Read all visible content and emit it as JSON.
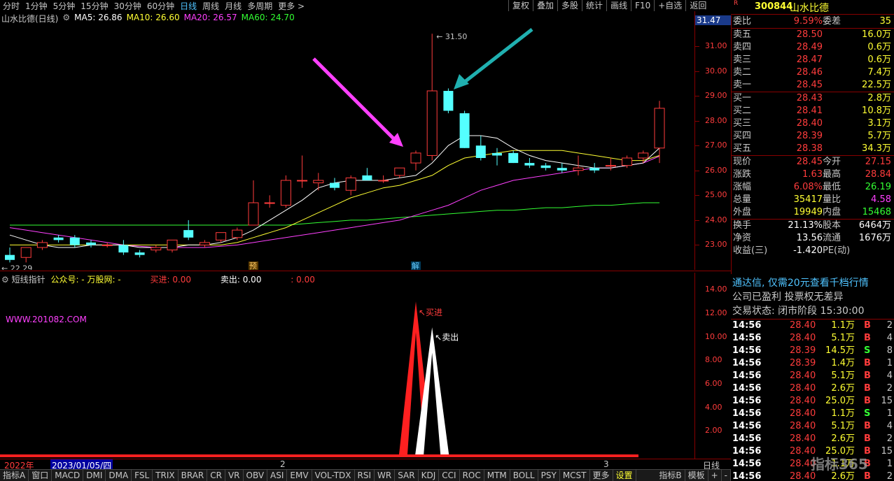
{
  "toolbar": {
    "tabs": [
      "分时",
      "1分钟",
      "5分钟",
      "15分钟",
      "30分钟",
      "60分钟",
      "日线",
      "周线",
      "月线",
      "多周期",
      "更多 >"
    ],
    "active": "日线",
    "right": [
      "复权",
      "叠加",
      "多股",
      "统计",
      "画线",
      "F10",
      "+自选",
      "返回"
    ]
  },
  "stock": {
    "badge": "R",
    "code": "300844",
    "name": "山水比德"
  },
  "main_chart": {
    "title": "山水比德(日线)",
    "ma_labels": [
      {
        "text": "MA5: 26.86",
        "color": "#ffffff"
      },
      {
        "text": "MA10: 26.60",
        "color": "#ffff33"
      },
      {
        "text": "MA20: 26.57",
        "color": "#ff40ff"
      },
      {
        "text": "MA60: 24.70",
        "color": "#33ff33"
      }
    ],
    "axis_ticks": [
      "31.00",
      "30.00",
      "29.00",
      "28.00",
      "27.00",
      "26.00",
      "25.00",
      "24.00",
      "23.00"
    ],
    "axis_top_value": "31.47",
    "high_label": "31.50",
    "low_label": "22.29",
    "marker_yu": "预",
    "marker_jie": "解"
  },
  "chart_data": {
    "type": "candlestick",
    "ylim": [
      22.0,
      31.9
    ],
    "candles": [
      [
        22.6,
        22.9,
        22.3,
        22.4
      ],
      [
        22.5,
        22.9,
        22.3,
        22.9
      ],
      [
        22.9,
        23.2,
        22.8,
        23.1
      ],
      [
        23.3,
        23.4,
        23.1,
        23.2
      ],
      [
        23.3,
        23.4,
        22.9,
        23.0
      ],
      [
        23.1,
        23.2,
        22.9,
        23.0
      ],
      [
        23.0,
        23.1,
        22.9,
        23.0
      ],
      [
        23.0,
        23.2,
        22.6,
        22.7
      ],
      [
        22.7,
        22.8,
        22.5,
        22.6
      ],
      [
        22.8,
        23.0,
        22.7,
        22.9
      ],
      [
        22.8,
        23.2,
        22.7,
        23.2
      ],
      [
        23.6,
        24.0,
        23.2,
        23.3
      ],
      [
        23.0,
        23.2,
        22.9,
        23.1
      ],
      [
        23.2,
        23.5,
        23.1,
        23.5
      ],
      [
        23.3,
        23.7,
        23.2,
        23.6
      ],
      [
        23.8,
        25.6,
        23.8,
        24.7
      ],
      [
        24.7,
        25.0,
        24.5,
        24.7
      ],
      [
        24.6,
        25.8,
        24.5,
        25.6
      ],
      [
        25.6,
        26.6,
        25.3,
        25.6
      ],
      [
        25.5,
        25.9,
        25.2,
        25.6
      ],
      [
        25.5,
        25.7,
        25.2,
        25.3
      ],
      [
        25.2,
        25.8,
        25.0,
        25.7
      ],
      [
        25.8,
        26.1,
        25.6,
        25.6
      ],
      [
        25.6,
        25.8,
        25.5,
        25.6
      ],
      [
        25.8,
        26.0,
        25.7,
        26.1
      ],
      [
        26.3,
        26.8,
        26.0,
        26.7
      ],
      [
        26.6,
        31.5,
        26.4,
        29.2
      ],
      [
        29.2,
        29.3,
        28.3,
        28.4
      ],
      [
        28.3,
        28.4,
        26.9,
        26.9
      ],
      [
        27.0,
        27.4,
        26.4,
        26.5
      ],
      [
        26.7,
        26.9,
        26.2,
        26.6
      ],
      [
        26.7,
        26.8,
        26.3,
        26.3
      ],
      [
        26.3,
        26.5,
        26.1,
        26.2
      ],
      [
        26.2,
        26.3,
        26.0,
        26.1
      ],
      [
        26.1,
        26.3,
        25.9,
        26.0
      ],
      [
        26.0,
        26.6,
        25.8,
        26.1
      ],
      [
        26.1,
        26.3,
        25.9,
        26.0
      ],
      [
        26.2,
        26.5,
        26.0,
        26.2
      ],
      [
        26.2,
        26.6,
        26.1,
        26.5
      ],
      [
        26.5,
        26.8,
        26.3,
        26.7
      ],
      [
        26.9,
        28.8,
        26.3,
        28.5
      ]
    ],
    "ma5": [
      23.4,
      23.2,
      23.0,
      22.9,
      22.9,
      23.0,
      23.0,
      23.0,
      22.9,
      22.9,
      22.9,
      23.0,
      23.0,
      23.1,
      23.3,
      23.6,
      24.0,
      24.4,
      24.8,
      25.3,
      25.5,
      25.6,
      25.6,
      25.6,
      25.7,
      25.8,
      26.3,
      27.0,
      27.4,
      27.4,
      27.3,
      26.9,
      26.6,
      26.4,
      26.3,
      26.2,
      26.1,
      26.1,
      26.2,
      26.3,
      26.9
    ],
    "ma10": [
      23.0,
      23.0,
      23.0,
      23.0,
      23.0,
      23.0,
      23.0,
      23.0,
      23.0,
      23.0,
      23.0,
      23.0,
      23.0,
      23.0,
      23.1,
      23.3,
      23.5,
      23.7,
      24.0,
      24.3,
      24.6,
      24.9,
      25.1,
      25.3,
      25.4,
      25.6,
      25.8,
      26.2,
      26.5,
      26.6,
      26.7,
      26.8,
      26.8,
      26.8,
      26.8,
      26.7,
      26.6,
      26.5,
      26.4,
      26.4,
      26.6
    ],
    "ma20": [
      23.7,
      23.6,
      23.5,
      23.4,
      23.3,
      23.2,
      23.1,
      23.0,
      22.95,
      22.9,
      22.9,
      22.9,
      22.9,
      22.95,
      23.0,
      23.1,
      23.2,
      23.3,
      23.4,
      23.5,
      23.6,
      23.7,
      23.8,
      23.9,
      24.0,
      24.2,
      24.4,
      24.6,
      24.9,
      25.2,
      25.4,
      25.6,
      25.7,
      25.8,
      25.9,
      26.0,
      26.1,
      26.1,
      26.2,
      26.3,
      26.57
    ],
    "ma60": [
      23.8,
      23.8,
      23.8,
      23.8,
      23.8,
      23.8,
      23.8,
      23.8,
      23.8,
      23.8,
      23.8,
      23.8,
      23.8,
      23.8,
      23.8,
      23.8,
      23.8,
      23.8,
      23.85,
      23.9,
      23.95,
      24.0,
      24.0,
      24.05,
      24.1,
      24.15,
      24.2,
      24.25,
      24.3,
      24.35,
      24.4,
      24.4,
      24.45,
      24.5,
      24.5,
      24.55,
      24.6,
      24.6,
      24.65,
      24.7,
      24.7
    ],
    "sub_indicator": {
      "ylim": [
        0,
        14.5
      ],
      "buy_peak": 13.0,
      "sell_peak": 10.8
    }
  },
  "sub_chart": {
    "title": "短线指针",
    "gzh": "公众号: - 万股网: -",
    "buy_label": "买进: 0.00",
    "sell_label": "卖出: 0.00",
    "extra": ": 0.00",
    "site": "WWW.201082.COM",
    "axis_ticks": [
      "14.00",
      "12.00",
      "10.00",
      "8.00",
      "6.00",
      "4.00",
      "2.00"
    ],
    "buy_tag": "买进",
    "sell_tag": "卖出"
  },
  "date_strip": {
    "year": "2022年",
    "date": "2023/01/05/四",
    "m2": "2",
    "m3": "3",
    "right": "日线"
  },
  "order_book": {
    "weibi_label": "委比",
    "weibi_val": "9.59%",
    "weicha_label": "委差",
    "weicha_val": "35",
    "asks": [
      {
        "label": "卖五",
        "price": "28.50",
        "vol": "16.0万"
      },
      {
        "label": "卖四",
        "price": "28.49",
        "vol": "0.6万"
      },
      {
        "label": "卖三",
        "price": "28.47",
        "vol": "0.6万"
      },
      {
        "label": "卖二",
        "price": "28.46",
        "vol": "7.4万"
      },
      {
        "label": "卖一",
        "price": "28.45",
        "vol": "22.5万"
      }
    ],
    "bids": [
      {
        "label": "买一",
        "price": "28.43",
        "vol": "2.8万"
      },
      {
        "label": "买二",
        "price": "28.41",
        "vol": "10.8万"
      },
      {
        "label": "买三",
        "price": "28.40",
        "vol": "3.1万"
      },
      {
        "label": "买四",
        "price": "28.39",
        "vol": "5.7万"
      },
      {
        "label": "买五",
        "price": "28.38",
        "vol": "34.3万"
      }
    ],
    "stats": [
      {
        "l1": "现价",
        "v1": "28.45",
        "c1": "#ff3c3c",
        "l2": "今开",
        "v2": "27.15",
        "c2": "#ff3c3c"
      },
      {
        "l1": "涨跌",
        "v1": "1.63",
        "c1": "#ff3c3c",
        "l2": "最高",
        "v2": "28.84",
        "c2": "#ff3c3c"
      },
      {
        "l1": "涨幅",
        "v1": "6.08%",
        "c1": "#ff3c3c",
        "l2": "最低",
        "v2": "26.19",
        "c2": "#33ff33"
      },
      {
        "l1": "总量",
        "v1": "35417",
        "c1": "#ffff33",
        "l2": "量比",
        "v2": "4.58",
        "c2": "#ff40ff"
      },
      {
        "l1": "外盘",
        "v1": "19949",
        "c1": "#ffff33",
        "l2": "内盘",
        "v2": "15468",
        "c2": "#33ff33"
      }
    ],
    "stats2": [
      {
        "l1": "换手",
        "v1": "21.13%",
        "c1": "#ffffff",
        "l2": "股本",
        "v2": "6464万",
        "c2": "#ffffff"
      },
      {
        "l1": "净资",
        "v1": "13.56",
        "c1": "#ffffff",
        "l2": "流通",
        "v2": "1676万",
        "c2": "#ffffff"
      },
      {
        "l1": "收益(三)",
        "v1": "-1.420",
        "c1": "#ffffff",
        "l2": "PE(动)",
        "v2": "",
        "c2": "#ffffff"
      }
    ]
  },
  "info": {
    "ad1": "通达信, 仅需20元查看千档行情",
    "ad2": "公司已盈利 投票权无差异",
    "ad3": "交易状态: 闭市阶段 15:30:00"
  },
  "ticks": [
    {
      "t": "14:56",
      "p": "28.40",
      "v": "1.1万",
      "s": "B",
      "n": "2"
    },
    {
      "t": "14:56",
      "p": "28.40",
      "v": "5.1万",
      "s": "B",
      "n": "4"
    },
    {
      "t": "14:56",
      "p": "28.39",
      "v": "14.5万",
      "s": "S",
      "n": "8"
    },
    {
      "t": "14:56",
      "p": "28.39",
      "v": "1.4万",
      "s": "B",
      "n": "1"
    },
    {
      "t": "14:56",
      "p": "28.40",
      "v": "5.1万",
      "s": "B",
      "n": "4"
    },
    {
      "t": "14:56",
      "p": "28.40",
      "v": "2.6万",
      "s": "B",
      "n": "2"
    },
    {
      "t": "14:56",
      "p": "28.40",
      "v": "25.0万",
      "s": "B",
      "n": "15"
    },
    {
      "t": "14:56",
      "p": "28.40",
      "v": "1.1万",
      "s": "S",
      "n": "1"
    },
    {
      "t": "14:56",
      "p": "28.40",
      "v": "5.1万",
      "s": "B",
      "n": "4"
    },
    {
      "t": "14:56",
      "p": "28.40",
      "v": "2.6万",
      "s": "B",
      "n": "2"
    },
    {
      "t": "14:56",
      "p": "28.40",
      "v": "25.0万",
      "s": "B",
      "n": "15"
    },
    {
      "t": "14:56",
      "p": "28.40",
      "v": "1.1万",
      "s": "B",
      "n": "1"
    },
    {
      "t": "14:56",
      "p": "28.40",
      "v": "2.6万",
      "s": "B",
      "n": "2"
    }
  ],
  "bottom": {
    "tabs": [
      "指标A",
      "窗口",
      "MACD",
      "DMI",
      "DMA",
      "FSL",
      "TRIX",
      "BRAR",
      "CR",
      "VR",
      "OBV",
      "ASI",
      "EMV",
      "VOL-TDX",
      "RSI",
      "WR",
      "SAR",
      "KDJ",
      "CCI",
      "ROC",
      "MTM",
      "BOLL",
      "PSY",
      "MCST",
      "更多",
      "设置"
    ],
    "right": [
      "指标B",
      "模板",
      "+",
      "-"
    ]
  },
  "watermark": "指标365"
}
